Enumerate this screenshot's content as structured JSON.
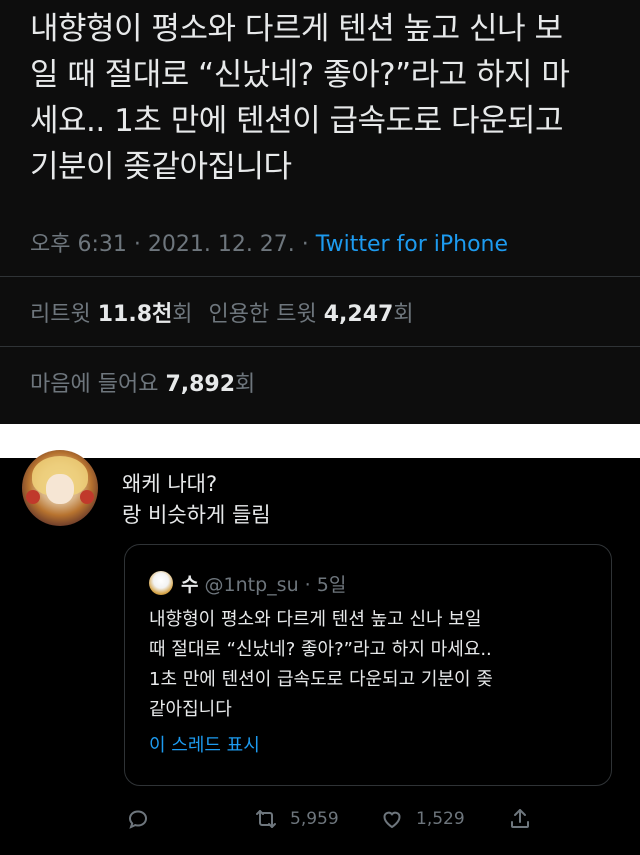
{
  "main_tweet": {
    "text_lines": [
      "내향형이 평소와 다르게 텐션 높고 신나 보",
      "일 때 절대로 “신났네? 좋아?”라고 하지 마",
      "세요.. 1초 만에 텐션이 급속도로 다운되고",
      "기분이 좆같아집니다"
    ],
    "time": "오후 6:31 · 2021. 12. 27. ·",
    "source": "Twitter for iPhone",
    "retweets_label": "리트윗",
    "retweets_count": "11.8천",
    "retweets_unit": "회",
    "quotes_label": "인용한 트윗",
    "quotes_count": "4,247",
    "quotes_unit": "회",
    "likes_label": "마음에 들어요",
    "likes_count": "7,892",
    "likes_unit": "회"
  },
  "reply": {
    "lines": [
      "왜케 나대?",
      "랑 비슷하게 들림"
    ]
  },
  "quote": {
    "name": "수",
    "handle_time": "@1ntp_su · 5일",
    "text_lines": [
      "내향형이 평소와 다르게 텐션 높고 신나 보일",
      "때 절대로 “신났네? 좋아?”라고 하지 마세요..",
      "1초 만에 텐션이 급속도로 다운되고 기분이 좆",
      "같아집니다"
    ],
    "show_thread": "이 스레드 표시"
  },
  "actions": {
    "retweet_count": "5,959",
    "like_count": "1,529"
  },
  "colors": {
    "accent": "#1d9bf0",
    "muted": "#6e767d",
    "text": "#e7e9ea",
    "background": "#000000"
  },
  "icons": [
    "reply-icon",
    "retweet-icon",
    "like-icon",
    "share-icon"
  ]
}
